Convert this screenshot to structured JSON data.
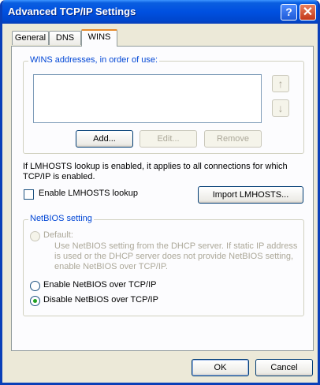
{
  "window": {
    "title": "Advanced TCP/IP Settings",
    "help_label": "?",
    "close_label": "✕"
  },
  "tabs": [
    {
      "label": "General"
    },
    {
      "label": "DNS"
    },
    {
      "label": "WINS",
      "active": true
    }
  ],
  "wins": {
    "group_label": "WINS addresses, in order of use:",
    "up_arrow": "↑",
    "down_arrow": "↓",
    "add_label": "Add...",
    "edit_label": "Edit...",
    "remove_label": "Remove"
  },
  "lmhosts": {
    "info": "If LMHOSTS lookup is enabled, it applies to all connections for which TCP/IP is enabled.",
    "enable_label": "Enable LMHOSTS lookup",
    "enable_checked": false,
    "import_label": "Import LMHOSTS..."
  },
  "netbios": {
    "group_label": "NetBIOS setting",
    "default_label": "Default:",
    "default_desc": "Use NetBIOS setting from the DHCP server. If static IP address is used or the DHCP server does not provide NetBIOS setting, enable NetBIOS over TCP/IP.",
    "enable_label": "Enable NetBIOS over TCP/IP",
    "disable_label": "Disable NetBIOS over TCP/IP",
    "selected": "disable"
  },
  "footer": {
    "ok_label": "OK",
    "cancel_label": "Cancel"
  }
}
